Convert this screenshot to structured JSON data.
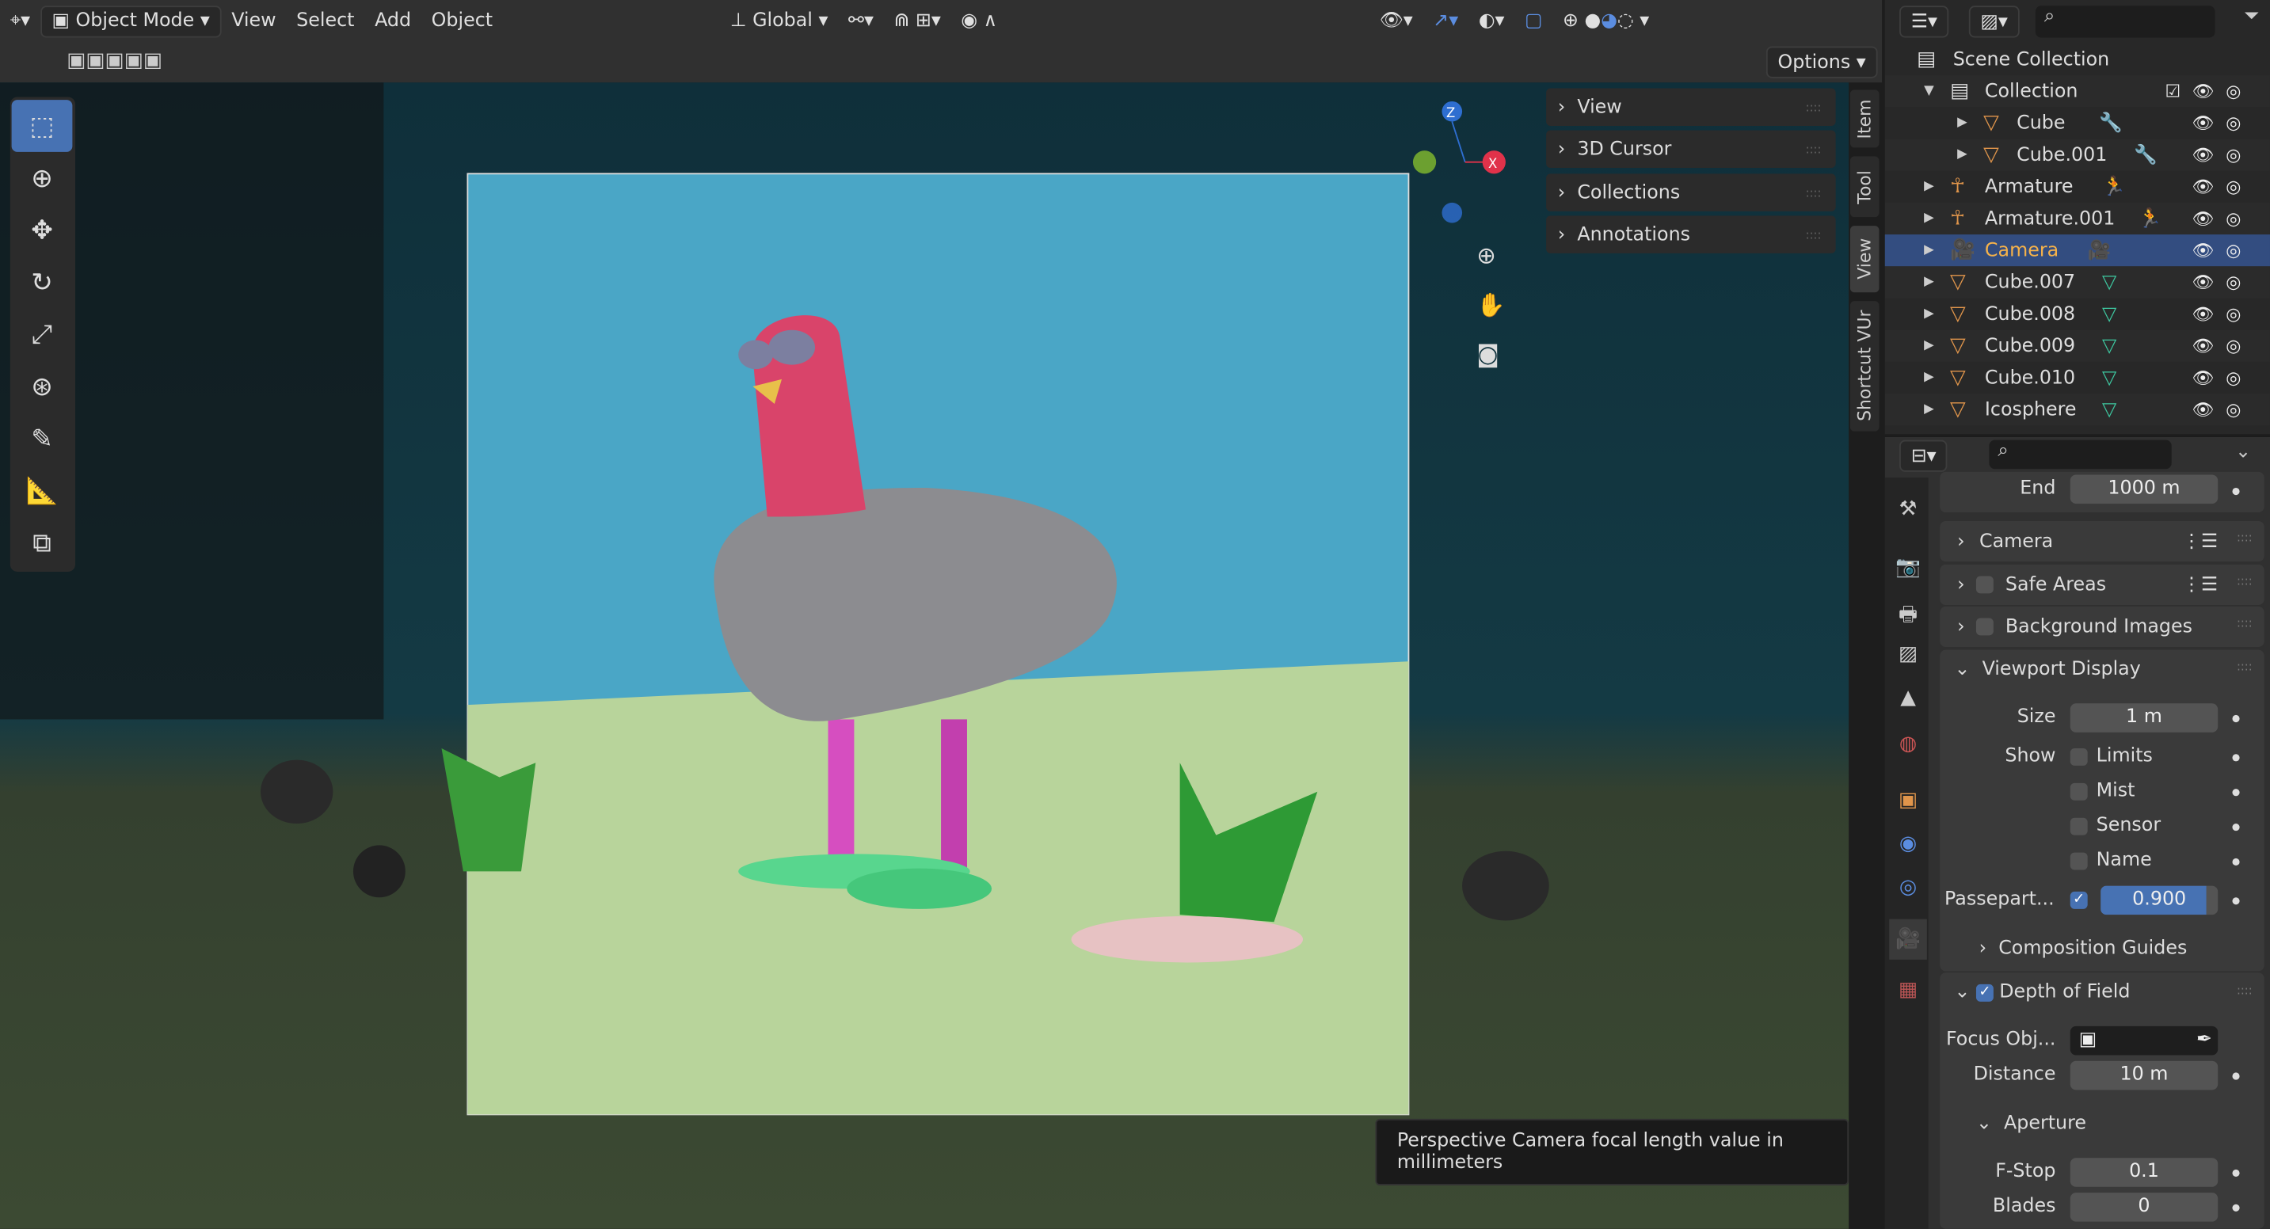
{
  "header": {
    "mode": "Object Mode",
    "menus": [
      "View",
      "Select",
      "Add",
      "Object"
    ],
    "orientation": "Global",
    "options": "Options"
  },
  "toolbar": {
    "tools": [
      "select-box",
      "cursor",
      "move",
      "rotate",
      "scale",
      "transform",
      "annotate",
      "measure",
      "add-cube"
    ]
  },
  "npanel": {
    "sections": [
      "View",
      "3D Cursor",
      "Collections",
      "Annotations"
    ],
    "tabs": [
      "Item",
      "Tool",
      "View",
      "Shortcut VUr"
    ]
  },
  "gizmo": {
    "axes": [
      "Z",
      "X"
    ]
  },
  "tooltip": "Perspective Camera focal length value in millimeters",
  "outliner": {
    "root": "Scene Collection",
    "items": [
      {
        "name": "Collection",
        "type": "collection"
      },
      {
        "name": "Cube",
        "type": "mesh"
      },
      {
        "name": "Cube.001",
        "type": "mesh"
      },
      {
        "name": "Armature",
        "type": "armature"
      },
      {
        "name": "Armature.001",
        "type": "armature"
      },
      {
        "name": "Camera",
        "type": "camera",
        "selected": true
      },
      {
        "name": "Cube.007",
        "type": "mesh"
      },
      {
        "name": "Cube.008",
        "type": "mesh"
      },
      {
        "name": "Cube.009",
        "type": "mesh"
      },
      {
        "name": "Cube.010",
        "type": "mesh"
      },
      {
        "name": "Icosphere",
        "type": "mesh"
      }
    ]
  },
  "properties": {
    "end_label": "End",
    "end_value": "1000 m",
    "camera": "Camera",
    "safe_areas": "Safe Areas",
    "background_images": "Background Images",
    "viewport_display": "Viewport Display",
    "size_label": "Size",
    "size_value": "1 m",
    "show_label": "Show",
    "show_limits": "Limits",
    "show_mist": "Mist",
    "show_sensor": "Sensor",
    "show_name": "Name",
    "passepartout_label": "Passepart...",
    "passepartout_value": "0.900",
    "passepartout_fraction": 0.9,
    "composition_guides": "Composition Guides",
    "depth_of_field": "Depth of Field",
    "focus_label": "Focus Obj...",
    "distance_label": "Distance",
    "distance_value": "10 m",
    "aperture": "Aperture",
    "fstop_label": "F-Stop",
    "fstop_value": "0.1",
    "blades_label": "Blades",
    "blades_value": "0"
  },
  "colors": {
    "accent": "#4772b3",
    "selected_row": "#334d80",
    "object_orange": "#e0954b",
    "data_green": "#3ec8a0"
  }
}
